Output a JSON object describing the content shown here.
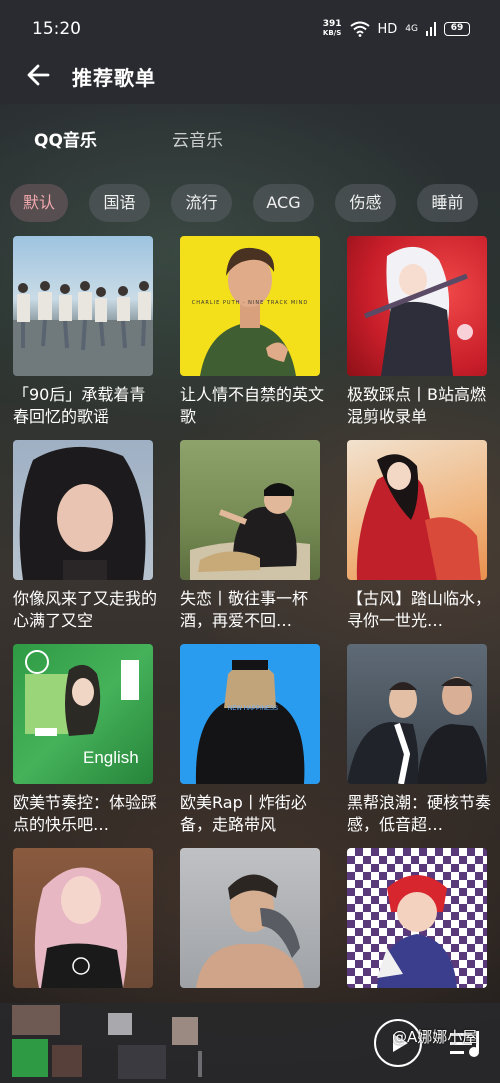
{
  "status": {
    "time": "15:20",
    "netspeed_value": "391",
    "netspeed_unit": "KB/S",
    "hd": "HD",
    "network": "4G",
    "battery": "69"
  },
  "header": {
    "title": "推荐歌单"
  },
  "tabs": [
    {
      "label": "QQ音乐"
    },
    {
      "label": "云音乐"
    }
  ],
  "chips": [
    {
      "label": "默认"
    },
    {
      "label": "国语"
    },
    {
      "label": "流行"
    },
    {
      "label": "ACG"
    },
    {
      "label": "伤感"
    },
    {
      "label": "睡前"
    }
  ],
  "playlists": [
    {
      "title": "「90后」承载着青春回忆的歌谣"
    },
    {
      "title": "让人情不自禁的英文歌",
      "cover_text": "CHARLIE PUTH · NINE TRACK MIND"
    },
    {
      "title": "极致踩点丨B站高燃混剪收录单"
    },
    {
      "title": "你像风来了又走我的心满了又空"
    },
    {
      "title": "失恋丨敬往事一杯酒，再爱不回…"
    },
    {
      "title": "【古风】踏山临水，寻你一世光…"
    },
    {
      "title": "欧美节奏控：体验踩点的快乐吧…",
      "cover_text": "English"
    },
    {
      "title": "欧美Rap丨炸街必备，走路带风",
      "cover_text": "NEW HAPPINESS"
    },
    {
      "title": "黑帮浪潮：硬核节奏感，低音超…"
    },
    {
      "title": ""
    },
    {
      "title": ""
    },
    {
      "title": ""
    }
  ],
  "watermark": "@A娜娜小屋",
  "colors": {
    "accent_chip": "#f2a9ae",
    "topbar": "#2a2b30"
  }
}
